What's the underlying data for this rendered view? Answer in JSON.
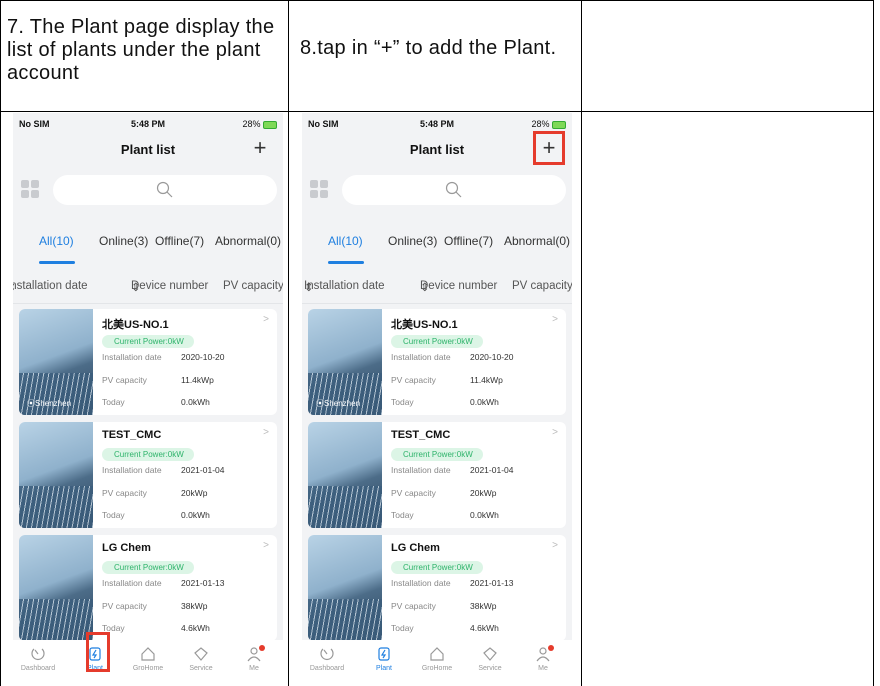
{
  "captions": [
    "7. The Plant page display the list of plants under the plant account",
    "8.tap in “+” to add the Plant.",
    ""
  ],
  "phone": {
    "status": {
      "carrier": "No SIM",
      "time": "5:48 PM",
      "battery": "28%"
    },
    "title": "Plant list",
    "add_icon": "+",
    "tabs": [
      "All(10)",
      "Online(3)",
      "Offline(7)",
      "Abnormal(0)"
    ],
    "sort": [
      "Installation date",
      "Device number",
      "PV capacity"
    ],
    "plants": [
      {
        "name": "北美US-NO.1",
        "power": "Current Power:0kW",
        "install_label": "Installation date",
        "install": "2020-10-20",
        "cap_label": "PV capacity",
        "capacity": "11.4kWp",
        "today_label": "Today",
        "today": "0.0kWh",
        "location": "Shenzhen"
      },
      {
        "name": "TEST_CMC",
        "power": "Current Power:0kW",
        "install_label": "Installation date",
        "install": "2021-01-04",
        "cap_label": "PV capacity",
        "capacity": "20kWp",
        "today_label": "Today",
        "today": "0.0kWh",
        "location": ""
      },
      {
        "name": "LG Chem",
        "power": "Current Power:0kW",
        "install_label": "Installation date",
        "install": "2021-01-13",
        "cap_label": "PV capacity",
        "capacity": "38kWp",
        "today_label": "Today",
        "today": "4.6kWh",
        "location": ""
      }
    ],
    "nav": [
      "Dashboard",
      "Plant",
      "GroHome",
      "Service",
      "Me"
    ]
  },
  "colors": {
    "accent": "#1f7fe0",
    "highlight": "#e53b2c",
    "online_badge": "#2db36a"
  }
}
